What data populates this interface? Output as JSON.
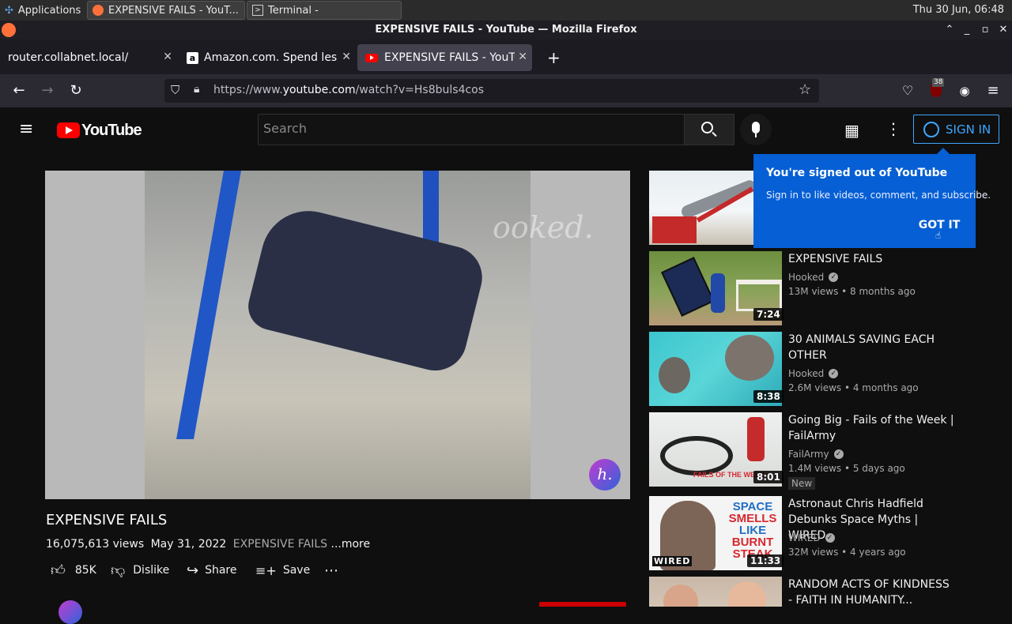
{
  "taskbar": {
    "applications": "Applications",
    "task_firefox": "EXPENSIVE FAILS - YouT...",
    "task_terminal": "Terminal -",
    "clock": "Thu 30 Jun, 06:48"
  },
  "window": {
    "title": "EXPENSIVE FAILS - YouTube — Mozilla Firefox"
  },
  "tabs": [
    {
      "label": "router.collabnet.local/"
    },
    {
      "label": "Amazon.com. Spend less"
    },
    {
      "label": "EXPENSIVE FAILS - YouTube"
    }
  ],
  "navbar": {
    "url_prefix": "https://www.",
    "url_host": "youtube.com",
    "url_path": "/watch?v=Hs8buls4cos",
    "extension_badge": "38"
  },
  "masthead": {
    "logo": "YouTube",
    "search_placeholder": "Search",
    "signin": "SIGN IN"
  },
  "popup": {
    "title": "You're signed out of YouTube",
    "body": "Sign in to like videos, comment, and subscribe.",
    "button": "GOT IT"
  },
  "video": {
    "title": "EXPENSIVE FAILS",
    "views": "16,075,613 views",
    "date": "May 31, 2022",
    "desc": "EXPENSIVE FAILS",
    "more": "...more",
    "watermark": "ooked.",
    "channel_mark": "h.",
    "likes": "85K",
    "dislike": "Dislike",
    "share": "Share",
    "save": "Save"
  },
  "recommendations": [
    {
      "title": "",
      "channel": "",
      "views": "",
      "age": "",
      "duration": ""
    },
    {
      "title": "EXPENSIVE FAILS",
      "channel": "Hooked",
      "views": "13M views",
      "age": "8 months ago",
      "duration": "7:24"
    },
    {
      "title": "30 ANIMALS SAVING EACH OTHER",
      "channel": "Hooked",
      "views": "2.6M views",
      "age": "4 months ago",
      "duration": "8:38"
    },
    {
      "title": "Going Big - Fails of the Week | FailArmy",
      "channel": "FailArmy",
      "views": "1.4M views",
      "age": "5 days ago",
      "duration": "8:01",
      "badge": "New",
      "thumb_text": "FAILS OF THE WEEK"
    },
    {
      "title": "Astronaut Chris Hadfield Debunks Space Myths | WIRED",
      "channel": "WIRED",
      "views": "32M views",
      "age": "4 years ago",
      "duration": "11:33",
      "thumb_lines": [
        "SPACE",
        "SMELLS",
        "LIKE",
        "BURNT",
        "STEAK"
      ],
      "thumb_brand": "WIRED"
    },
    {
      "title": "RANDOM ACTS OF KINDNESS - FAITH IN HUMANITY...",
      "channel": "",
      "views": "",
      "age": "",
      "duration": ""
    }
  ],
  "colors": {
    "accent": "#3ea6ff",
    "popup": "#065fd4",
    "youtube_red": "#ff0000"
  }
}
